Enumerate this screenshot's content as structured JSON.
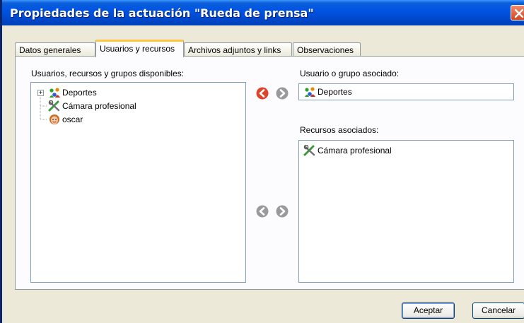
{
  "window": {
    "title": "Propiedades de la actuación \"Rueda de prensa\""
  },
  "tabs": [
    {
      "label": "Datos generales",
      "active": false
    },
    {
      "label": "Usuarios y recursos",
      "active": true
    },
    {
      "label": "Archivos adjuntos y links",
      "active": false
    },
    {
      "label": "Observaciones",
      "active": false
    }
  ],
  "available": {
    "label": "Usuarios, recursos y grupos disponibles:",
    "items": [
      {
        "label": "Deportes",
        "icon": "group-icon",
        "expandable": true
      },
      {
        "label": "Cámara profesional",
        "icon": "tools-icon"
      },
      {
        "label": "oscar",
        "icon": "user-icon"
      }
    ]
  },
  "associated_user": {
    "label": "Usuario o grupo asociado:",
    "value": "Deportes",
    "icon": "group-icon"
  },
  "associated_resources": {
    "label": "Recursos asociados:",
    "items": [
      {
        "label": "Cámara profesional",
        "icon": "tools-icon"
      }
    ]
  },
  "buttons": {
    "accept": "Aceptar",
    "cancel": "Cancelar"
  },
  "colors": {
    "titlebar": "#0054e3",
    "arrow_active": "#e0432c",
    "arrow_disabled": "#9a9a9a",
    "tab_highlight": "#ffc83c"
  }
}
